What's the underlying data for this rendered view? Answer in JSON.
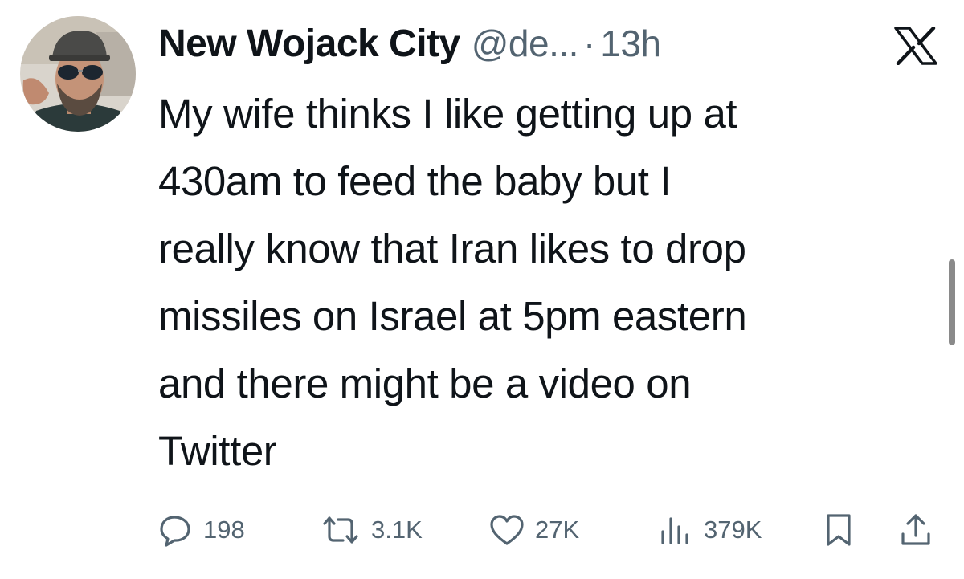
{
  "tweet": {
    "display_name": "New Wojack City",
    "handle": "@de...",
    "separator": "·",
    "time": "13h",
    "text": "My wife thinks I like getting up at\n430am to feed the baby but I\nreally know that Iran likes to drop\nmissiles on Israel at 5pm eastern\nand there might be a video on\nTwitter"
  },
  "actions": {
    "reply_count": "198",
    "retweet_count": "3.1K",
    "like_count": "27K",
    "views_count": "379K"
  },
  "icons": {
    "brand": "x-logo-icon",
    "reply": "reply-icon",
    "retweet": "retweet-icon",
    "like": "heart-icon",
    "views": "bar-chart-icon",
    "bookmark": "bookmark-icon",
    "share": "share-icon"
  },
  "colors": {
    "text": "#0f1419",
    "muted": "#536471",
    "background": "#ffffff"
  }
}
